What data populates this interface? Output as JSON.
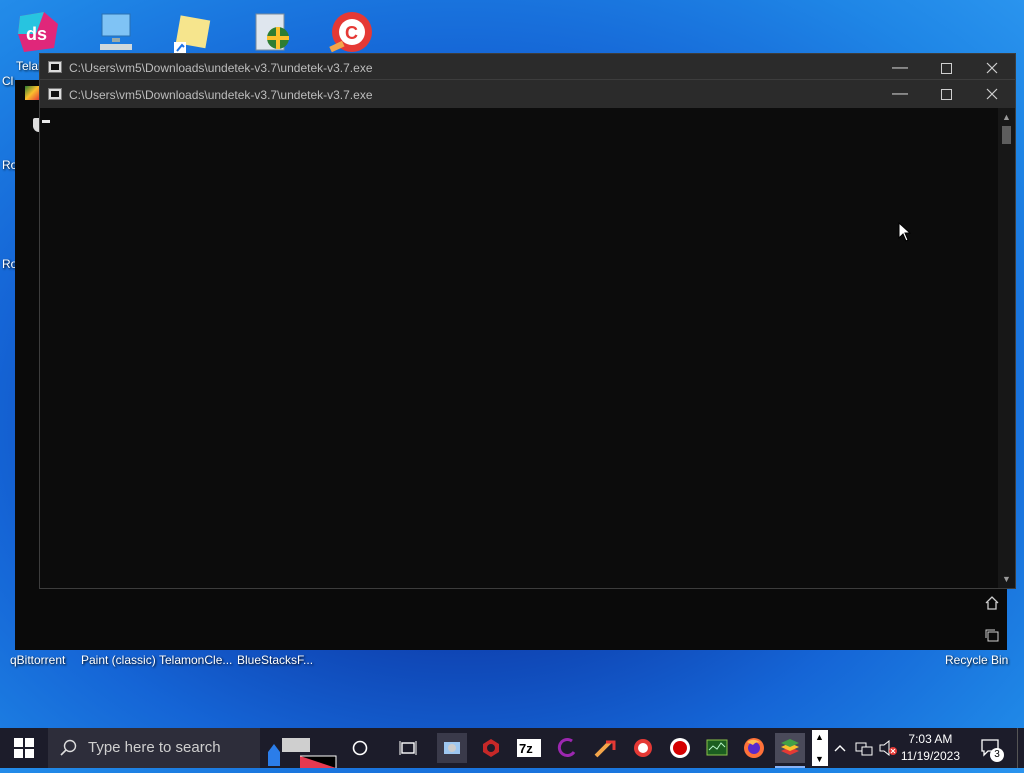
{
  "desktop": {
    "top_label_left": "Telan",
    "partial_labels": [
      "Cl",
      "Ro",
      "Ro"
    ],
    "bottom_labels": [
      "qBittorrent",
      "Paint (classic)",
      "TelamonCle...",
      "BlueStacksF...",
      "Recycle Bin"
    ],
    "icons": [
      "desktop-studio-icon",
      "this-pc-icon",
      "folder-shortcut-icon",
      "control-panel-icon",
      "ccleaner-icon"
    ]
  },
  "window_back": {
    "title": "C:\\Users\\vm5\\Downloads\\undetek-v3.7\\undetek-v3.7.exe"
  },
  "window_front": {
    "title": "C:\\Users\\vm5\\Downloads\\undetek-v3.7\\undetek-v3.7.exe"
  },
  "taskbar": {
    "search_placeholder": "Type here to search",
    "time": "7:03 AM",
    "date": "11/19/2023",
    "notification_count": "3",
    "apps": [
      "file-explorer",
      "red-hex-app",
      "7zip",
      "arc-app",
      "ccleaner-broom",
      "ccleaner",
      "recorder",
      "task-manager",
      "firefox",
      "bluestacks"
    ]
  },
  "colors": {
    "console_bg": "#0c0c0c",
    "titlebar_bg": "#2b2b2b",
    "taskbar_bg": "#1c1c2a"
  }
}
